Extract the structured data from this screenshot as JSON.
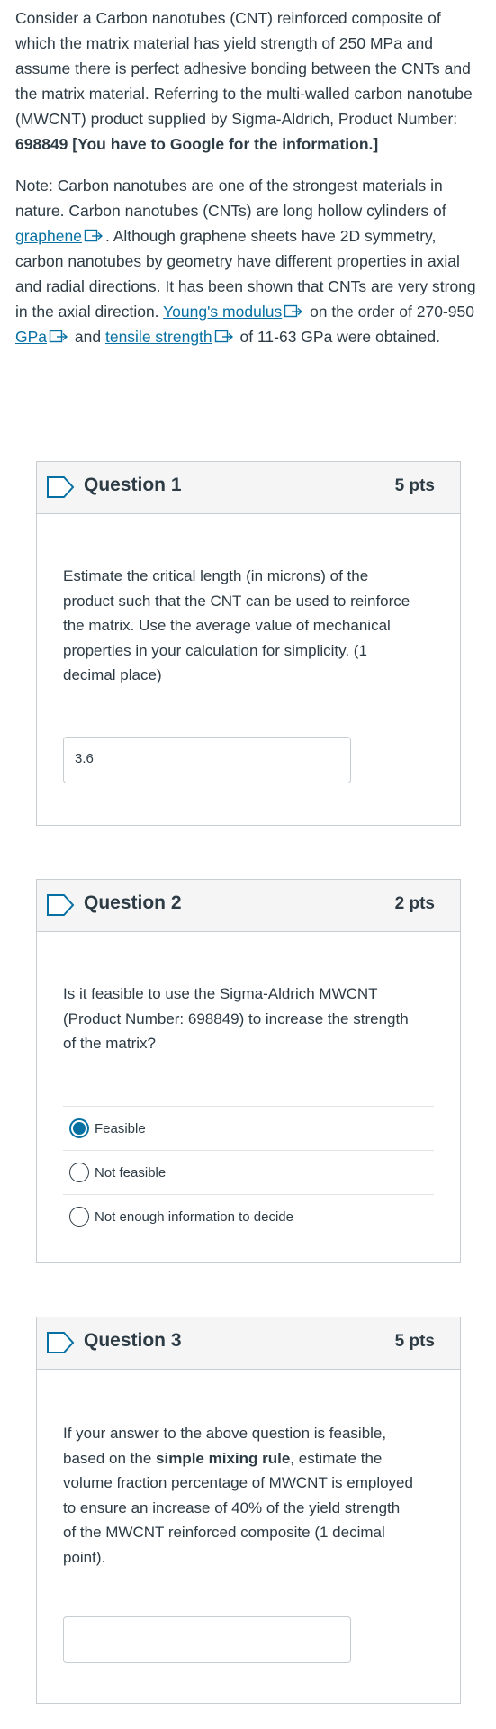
{
  "intro": {
    "p1_prefix": "Consider a Carbon nanotubes (CNT) reinforced composite of which the matrix material has yield strength of 250 MPa and assume there is perfect adhesive bonding between the CNTs and the matrix material.  Referring to the multi-walled carbon nanotube (MWCNT) product supplied by Sigma-Aldrich, Product Number: ",
    "p1_bold": "698849 [You have to Google for the information.]",
    "p2_a": "Note: Carbon nanotubes are one of the strongest materials in nature. Carbon nanotubes (CNTs) are long hollow cylinders of ",
    "link_graphene": "graphene",
    "p2_b": ". Although graphene sheets have 2D symmetry, carbon nanotubes by geometry have different properties in axial and radial directions. It has been shown that CNTs are very strong in the axial direction. ",
    "link_youngs": "Young's modulus",
    "p2_c": " on the order of 270-950 ",
    "link_gpa": "GPa",
    "p2_d": " and ",
    "link_tensile": "tensile strength",
    "p2_e": " of 11-63 GPa were obtained."
  },
  "questions": [
    {
      "title": "Question 1",
      "points": "5 pts",
      "text": "Estimate the critical length (in microns) of the product such that the CNT can be used to reinforce the matrix. Use the average value of mechanical properties in your calculation for simplicity.  (1 decimal place)",
      "answer": "3.6"
    },
    {
      "title": "Question 2",
      "points": "2 pts",
      "text": "Is it feasible to use the Sigma-Aldrich MWCNT (Product Number: 698849) to increase the strength of the matrix?",
      "options": [
        "Feasible",
        "Not feasible",
        "Not enough information to decide"
      ],
      "selected": "Feasible"
    },
    {
      "title": "Question 3",
      "points": "5 pts",
      "text_a": "If your answer to the above question is feasible, based on the ",
      "text_bold": "simple mixing rule",
      "text_b": ", estimate the volume fraction percentage of MWCNT is employed to ensure an increase of 40% of the yield strength of the MWCNT reinforced composite (1 decimal point).",
      "answer": ""
    }
  ],
  "colors": {
    "link": "#0770a3",
    "accent": "#0770a3",
    "text": "#2d3b45",
    "border": "#c7cdd1"
  },
  "icons": [
    "external-link-icon",
    "question-flag-icon",
    "radio-button-icon"
  ]
}
